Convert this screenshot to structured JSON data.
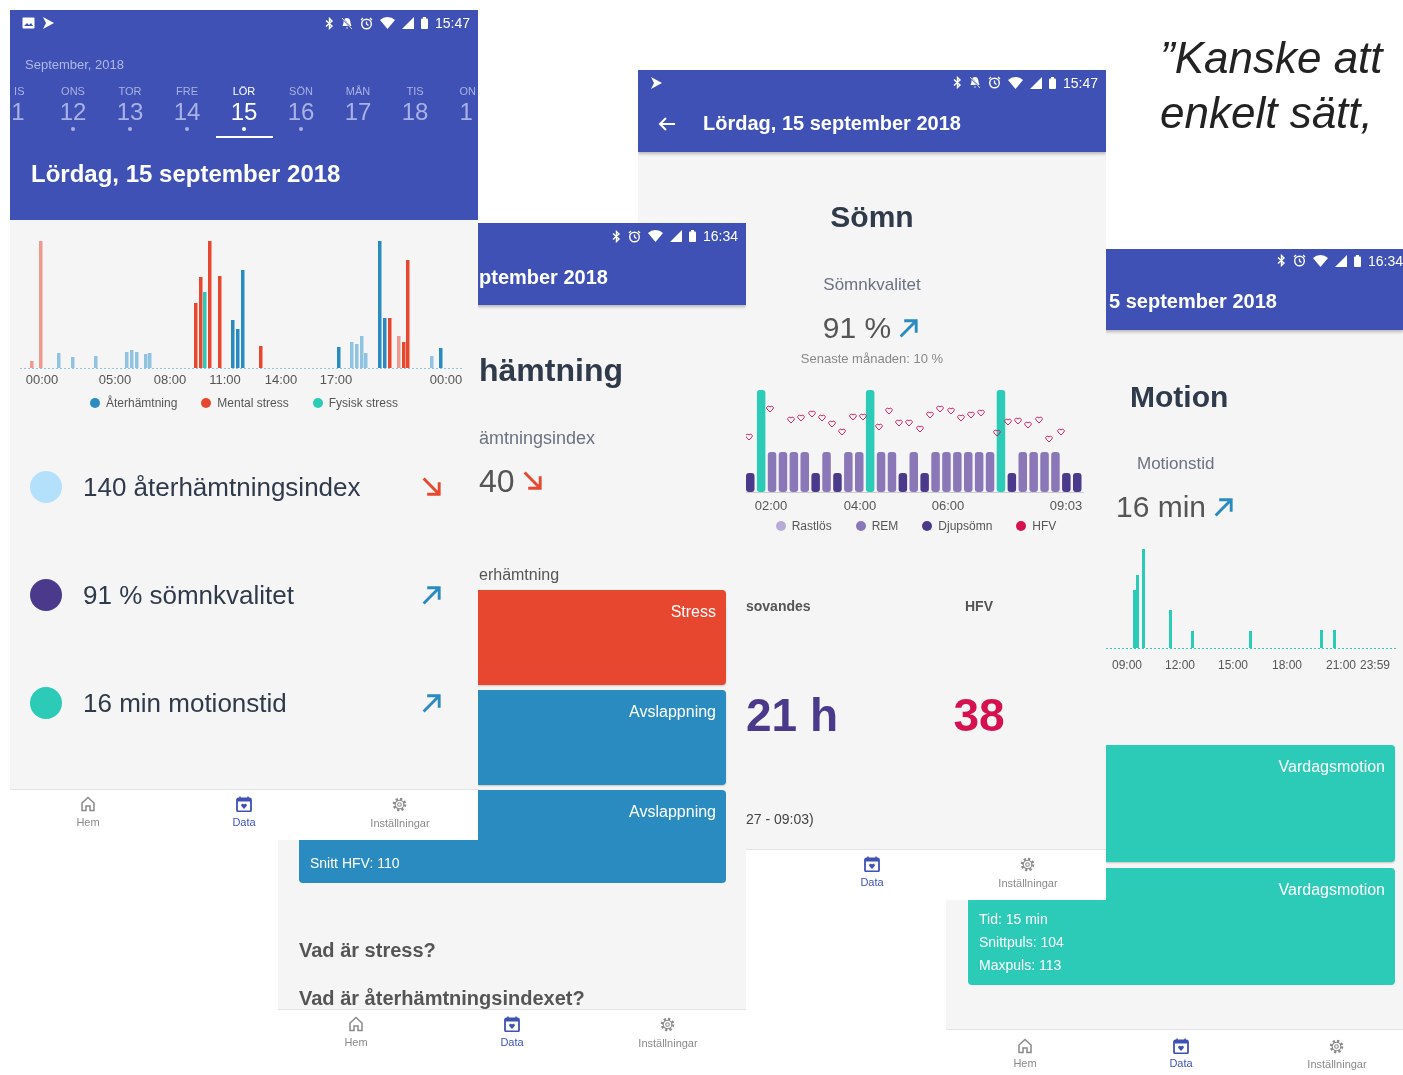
{
  "quote": {
    "lines": [
      "”Kanske att",
      "enkelt sätt,"
    ]
  },
  "overview_screen": {
    "status_time": "15:47",
    "month": "September, 2018",
    "days": [
      {
        "weekday": "IS",
        "date": "1",
        "dot": false,
        "selected": false
      },
      {
        "weekday": "ONS",
        "date": "12",
        "dot": true,
        "selected": false
      },
      {
        "weekday": "TOR",
        "date": "13",
        "dot": true,
        "selected": false
      },
      {
        "weekday": "FRE",
        "date": "14",
        "dot": true,
        "selected": false
      },
      {
        "weekday": "LÖR",
        "date": "15",
        "dot": true,
        "selected": true
      },
      {
        "weekday": "SÖN",
        "date": "16",
        "dot": true,
        "selected": false
      },
      {
        "weekday": "MÅN",
        "date": "17",
        "dot": false,
        "selected": false
      },
      {
        "weekday": "TIS",
        "date": "18",
        "dot": false,
        "selected": false
      },
      {
        "weekday": "ON",
        "date": "1",
        "dot": false,
        "selected": false
      }
    ],
    "title": "Lördag, 15 september 2018",
    "chart": {
      "x_ticks": [
        "00:00",
        "05:00",
        "08:00",
        "11:00",
        "14:00",
        "17:00",
        "00:00"
      ],
      "legend": [
        {
          "label": "Återhämtning",
          "color": "#2a8bc0"
        },
        {
          "label": "Mental stress",
          "color": "#e8472f"
        },
        {
          "label": "Fysisk stress",
          "color": "#2bcbb7"
        }
      ]
    },
    "metrics": [
      {
        "text": "140 återhämtningsindex",
        "color": "#b3e0fb",
        "kind": "down"
      },
      {
        "text": "91 % sömnkvalitet",
        "color": "#4b3a8c",
        "kind": "up"
      },
      {
        "text": "16 min motionstid",
        "color": "#2bcbb7",
        "kind": "up"
      }
    ],
    "nav": [
      {
        "label": "Hem",
        "kind": "home",
        "selected": false
      },
      {
        "label": "Data",
        "kind": "calendar",
        "selected": true
      },
      {
        "label": "Inställningar",
        "kind": "gear",
        "selected": false
      }
    ]
  },
  "recovery_screen": {
    "status_time": "16:34",
    "title": "ptember 2018",
    "heading": "hämtning",
    "index": {
      "label": "ämtningsindex",
      "value": "40",
      "kind": "down"
    },
    "section_label": "erhämtning",
    "cards": [
      {
        "label": "Stress",
        "kind": "stress"
      },
      {
        "label": "Avslappning",
        "kind": "relaxation"
      },
      {
        "label": "Avslappning",
        "kind": "relaxation",
        "details": [
          "Snitt HFV: 110"
        ]
      }
    ],
    "faq": [
      "Vad är stress?",
      "Vad är återhämtningsindexet?"
    ],
    "nav": [
      {
        "label": "Hem",
        "kind": "home",
        "selected": false
      },
      {
        "label": "Data",
        "kind": "calendar",
        "selected": true
      },
      {
        "label": "Inställningar",
        "kind": "gear",
        "selected": false
      }
    ]
  },
  "sleep_screen": {
    "status_time": "15:47",
    "title": "Lördag, 15 september 2018",
    "heading": "Sömn",
    "quality": {
      "label": "Sömnkvalitet",
      "value": "91 %",
      "kind": "up"
    },
    "comparison": "Senaste månaden: 10 %",
    "chart": {
      "x_ticks": [
        "02:00",
        "04:00",
        "06:00",
        "09:03"
      ],
      "legend": [
        {
          "label": "Rastlös",
          "color": "#b8acd6"
        },
        {
          "label": "REM",
          "color": "#8a77b8"
        },
        {
          "label": "Djupsömn",
          "color": "#4b3a8c"
        },
        {
          "label": "HFV",
          "color": "#d6114f"
        }
      ]
    },
    "stats": [
      {
        "label": "sovandes",
        "value": "21 h",
        "kind": "duration"
      },
      {
        "label": "HFV",
        "value": "38",
        "kind": "hrv"
      }
    ],
    "session_time": "27 - 09:03)",
    "nav": [
      {
        "label": "Data",
        "kind": "calendar",
        "selected": true
      },
      {
        "label": "Inställningar",
        "kind": "gear",
        "selected": false
      }
    ]
  },
  "exercise_screen": {
    "status_time": "16:34",
    "title": "5 september 2018",
    "heading": "Motion",
    "exercise_time": {
      "label": "Motionstid",
      "value": "16 min",
      "kind": "up"
    },
    "chart": {
      "x_ticks": [
        "09:00",
        "12:00",
        "15:00",
        "18:00",
        "21:00",
        "23:59"
      ]
    },
    "cards": [
      {
        "label": "Vardagsmotion"
      },
      {
        "label": "Vardagsmotion",
        "details": [
          "Tid: 15 min",
          "Snittpuls: 104",
          "Maxpuls: 113"
        ]
      }
    ],
    "nav": [
      {
        "label": "Hem",
        "kind": "home",
        "selected": false
      },
      {
        "label": "Data",
        "kind": "calendar",
        "selected": true
      },
      {
        "label": "Inställningar",
        "kind": "gear",
        "selected": false
      }
    ]
  }
}
